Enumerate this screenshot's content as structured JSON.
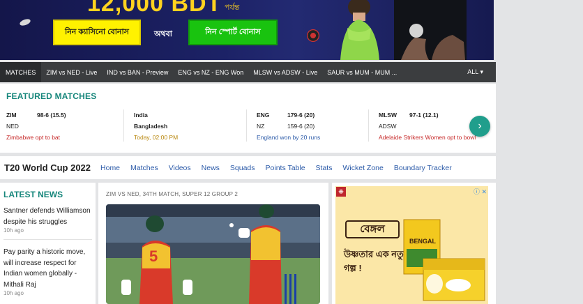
{
  "banner": {
    "amount": "12,000 BDT",
    "upto": "পর্যন্ত",
    "casino_button": "নিন ক্যাসিনো বোনাস",
    "or_text": "অথবা",
    "sports_button": "নিন স্পোর্ট বোনাস"
  },
  "ticker": {
    "items": [
      "MATCHES",
      "ZIM vs NED - Live",
      "IND vs BAN - Preview",
      "ENG vs NZ - ENG Won",
      "MLSW vs ADSW - Live",
      "SAUR vs MUM - MUM ..."
    ],
    "all_label": "ALL ▾"
  },
  "featured": {
    "title": "FEATURED MATCHES",
    "matches": [
      {
        "team1": "ZIM",
        "score1": "98-6 (15.5)",
        "team2": "NED",
        "score2": "",
        "status": "Zimbabwe opt to bat",
        "status_color": "#c62828"
      },
      {
        "team1": "India",
        "score1": "",
        "team2": "Bangladesh",
        "score2": "",
        "status": "Today, 02:00 PM",
        "status_color": "#b8860b"
      },
      {
        "team1": "ENG",
        "score1": "179-6 (20)",
        "team2": "NZ",
        "score2": "159-6 (20)",
        "status": "England won by 20 runs",
        "status_color": "#2b5aa8"
      },
      {
        "team1": "MLSW",
        "score1": "97-1 (12.1)",
        "team2": "ADSW",
        "score2": "",
        "status": "Adelaide Strikers Women opt to bowl",
        "status_color": "#c62828"
      }
    ],
    "next_icon": "›"
  },
  "series": {
    "title": "T20 World Cup 2022",
    "links": [
      "Home",
      "Matches",
      "Videos",
      "News",
      "Squads",
      "Points Table",
      "Stats",
      "Wicket Zone",
      "Boundary Tracker"
    ]
  },
  "news": {
    "title": "LATEST NEWS",
    "items": [
      {
        "headline": "Santner defends Williamson despite his struggles",
        "time": "10h ago"
      },
      {
        "headline": "Pay parity a historic move, will increase respect for Indian women globally - Mithali Raj",
        "time": "10h ago"
      }
    ]
  },
  "article": {
    "kicker": "ZIM VS NED, 34TH MATCH, SUPER 12 GROUP 2"
  },
  "ad": {
    "brand": "বেঙ্গল",
    "tagline": "উষ্ণতার এক নতুন গল্প !",
    "pack_label": "BENGAL",
    "close_label": "ⓘ ✕"
  }
}
